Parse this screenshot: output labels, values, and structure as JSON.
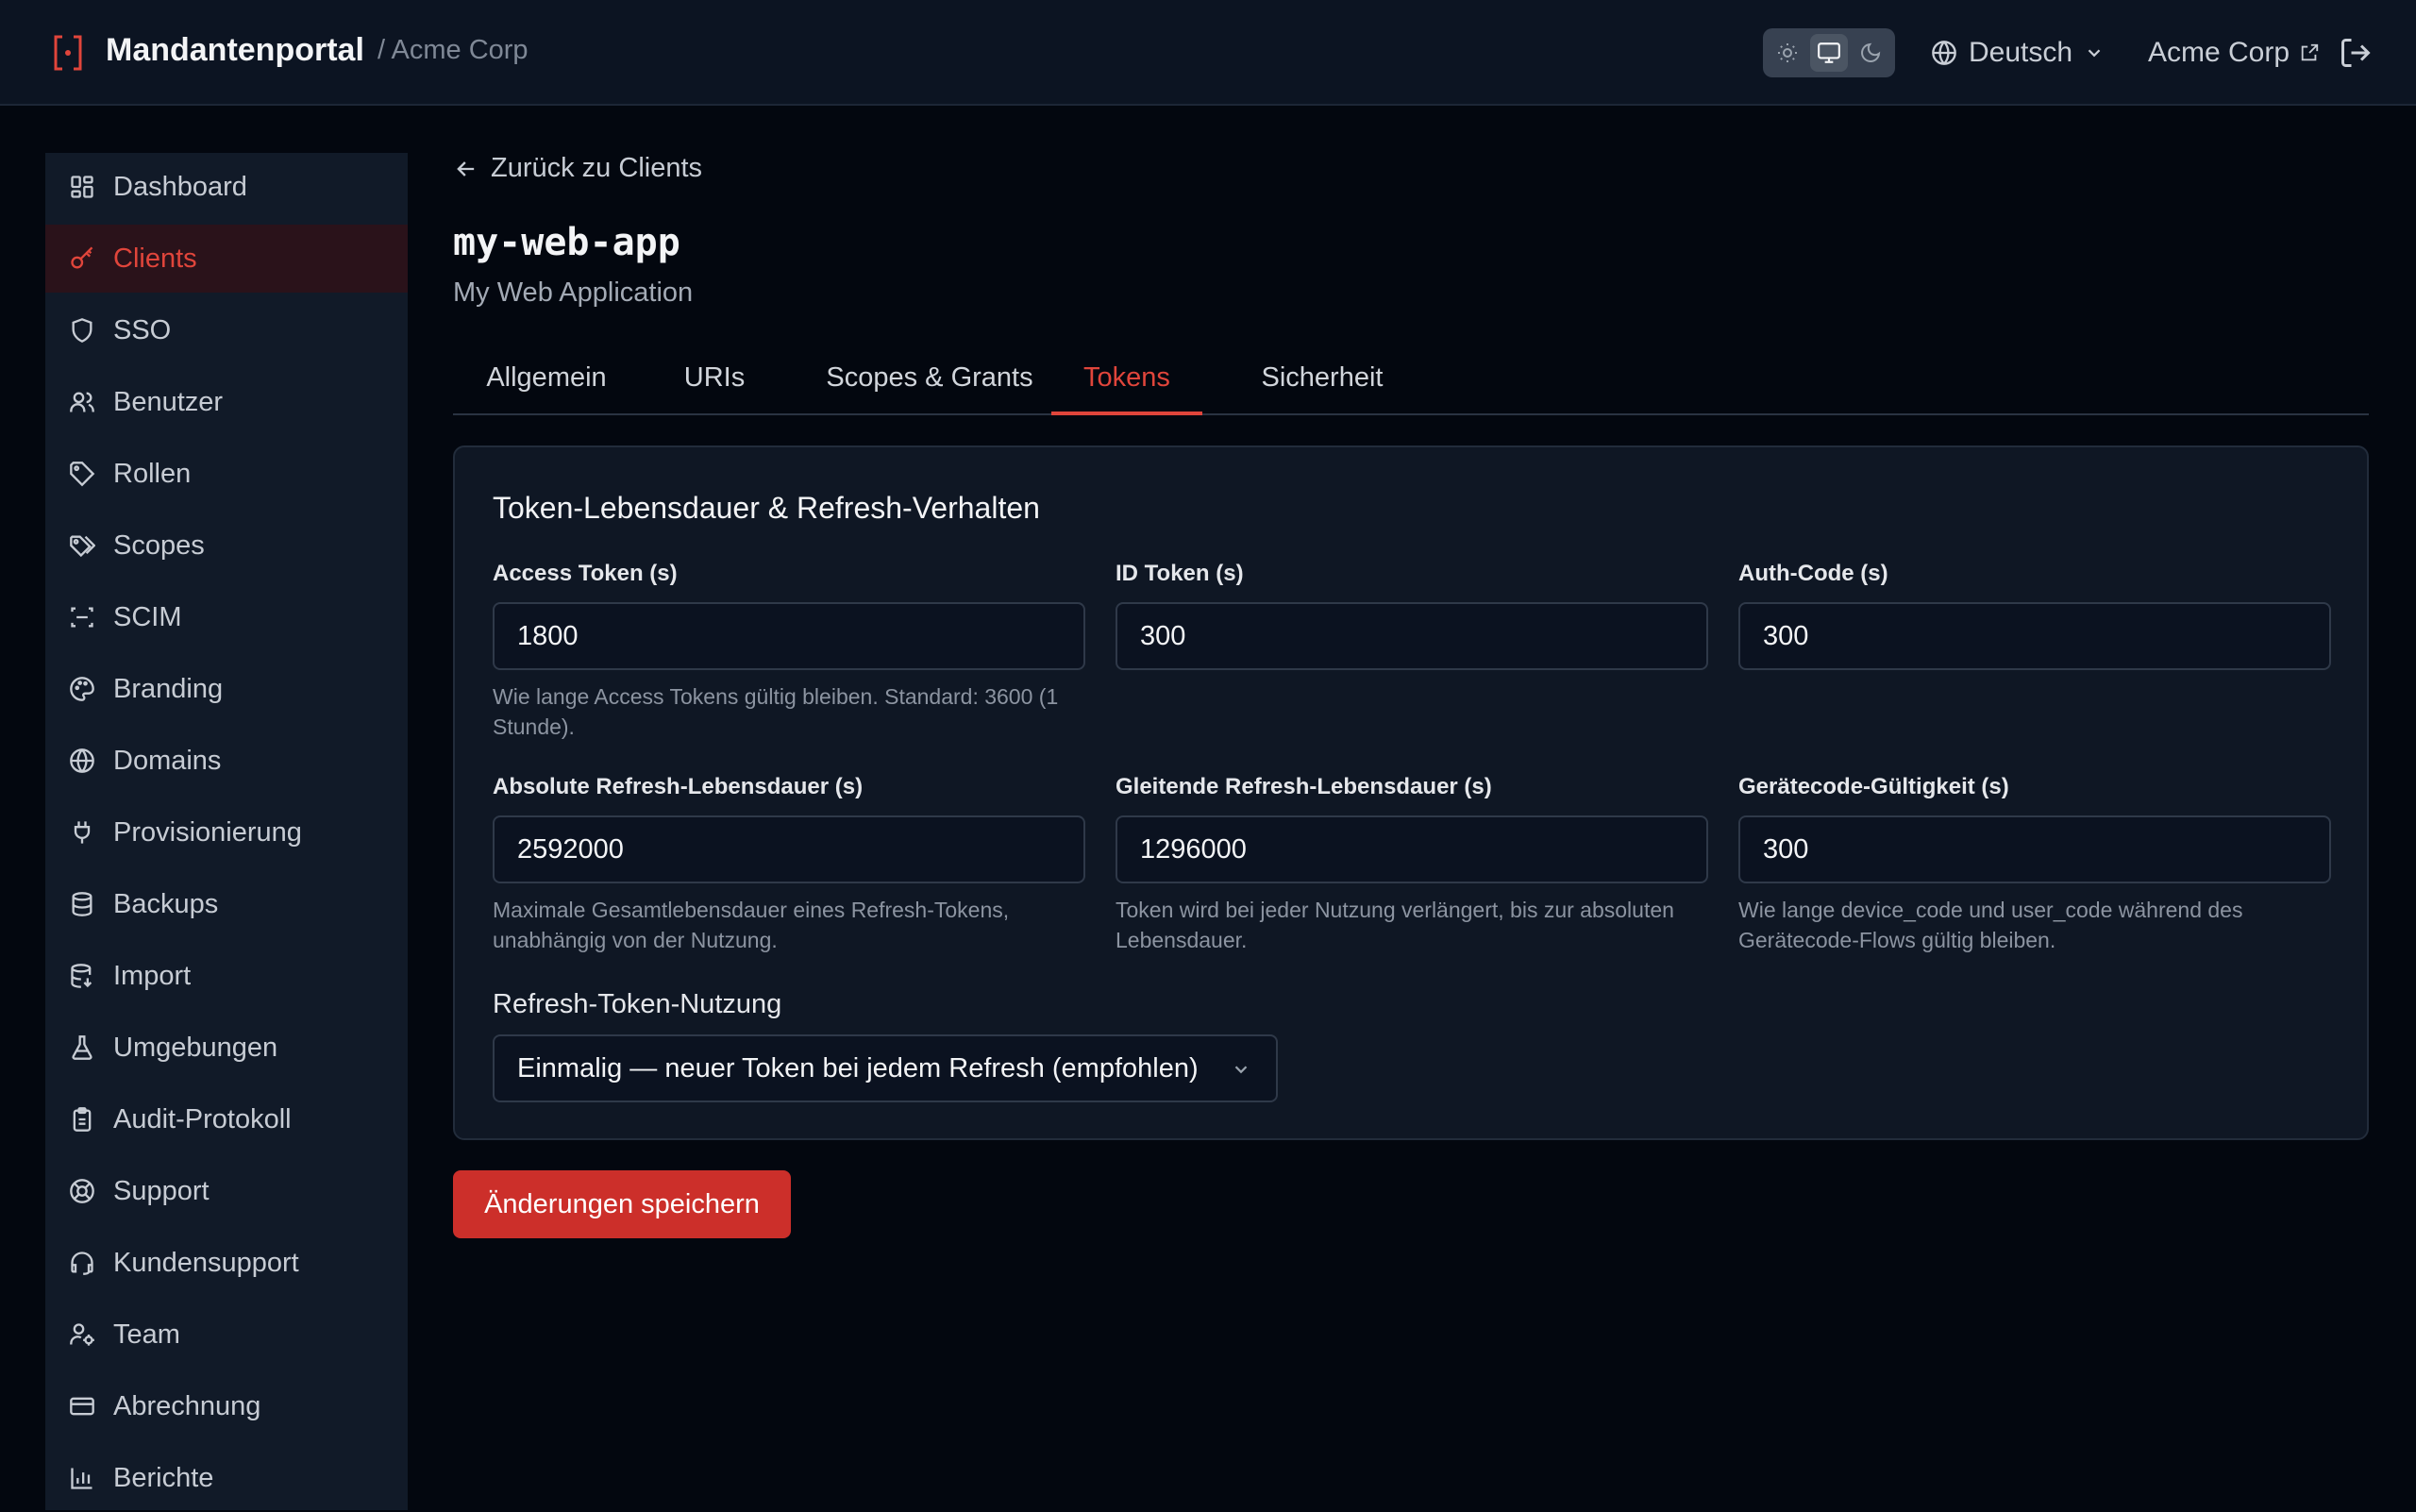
{
  "header": {
    "app_name": "Mandantenportal",
    "breadcrumb_tenant": "/ Acme Corp",
    "theme_modes": [
      "light",
      "system",
      "dark"
    ],
    "active_theme": "system",
    "language": "Deutsch",
    "organization": "Acme Corp",
    "icons": {
      "brand": "bracket-dot-logo",
      "language": "globe-icon",
      "external": "external-link-icon",
      "logout": "logout-icon"
    }
  },
  "sidebar": {
    "active": "Clients",
    "items": [
      {
        "label": "Dashboard",
        "icon": "dashboard-icon"
      },
      {
        "label": "Clients",
        "icon": "key-icon"
      },
      {
        "label": "SSO",
        "icon": "shield-icon"
      },
      {
        "label": "Benutzer",
        "icon": "users-icon"
      },
      {
        "label": "Rollen",
        "icon": "tag-icon"
      },
      {
        "label": "Scopes",
        "icon": "tags-icon"
      },
      {
        "label": "SCIM",
        "icon": "scan-icon"
      },
      {
        "label": "Branding",
        "icon": "palette-icon"
      },
      {
        "label": "Domains",
        "icon": "globe-icon"
      },
      {
        "label": "Provisionierung",
        "icon": "plug-icon"
      },
      {
        "label": "Backups",
        "icon": "database-icon"
      },
      {
        "label": "Import",
        "icon": "database-import-icon"
      },
      {
        "label": "Umgebungen",
        "icon": "flask-icon"
      },
      {
        "label": "Audit-Protokoll",
        "icon": "clipboard-icon"
      },
      {
        "label": "Support",
        "icon": "lifebuoy-icon"
      },
      {
        "label": "Kundensupport",
        "icon": "headset-icon"
      },
      {
        "label": "Team",
        "icon": "user-cog-icon"
      },
      {
        "label": "Abrechnung",
        "icon": "credit-card-icon"
      },
      {
        "label": "Berichte",
        "icon": "bar-chart-icon"
      }
    ]
  },
  "main": {
    "back_link": "Zurück zu Clients",
    "title": "my-web-app",
    "subtitle": "My Web Application",
    "tabs": [
      {
        "label": "Allgemein"
      },
      {
        "label": "URIs"
      },
      {
        "label": "Scopes & Grants"
      },
      {
        "label": "Tokens"
      },
      {
        "label": "Sicherheit"
      }
    ],
    "active_tab": "Tokens",
    "card": {
      "title": "Token-Lebensdauer & Refresh-Verhalten",
      "fields": [
        {
          "label": "Access Token (s)",
          "value": "1800",
          "help": "Wie lange Access Tokens gültig bleiben. Standard: 3600 (1 Stunde)."
        },
        {
          "label": "ID Token (s)",
          "value": "300",
          "help": ""
        },
        {
          "label": "Auth-Code (s)",
          "value": "300",
          "help": ""
        },
        {
          "label": "Absolute Refresh-Lebensdauer (s)",
          "value": "2592000",
          "help": "Maximale Gesamtlebensdauer eines Refresh-Tokens, unabhängig von der Nutzung."
        },
        {
          "label": "Gleitende Refresh-Lebensdauer (s)",
          "value": "1296000",
          "help": "Token wird bei jeder Nutzung verlängert, bis zur absoluten Lebensdauer."
        },
        {
          "label": "Gerätecode-Gültigkeit (s)",
          "value": "300",
          "help": "Wie lange device_code und user_code während des Gerätecode-Flows gültig bleiben."
        }
      ],
      "refresh_usage": {
        "label": "Refresh-Token-Nutzung",
        "selected": "Einmalig — neuer Token bei jedem Refresh (empfohlen)"
      }
    },
    "save_button": "Änderungen speichern"
  },
  "colors": {
    "accent": "#e0453b",
    "button": "#cc2f2a",
    "background": "#03070f",
    "panel": "#111a28"
  }
}
